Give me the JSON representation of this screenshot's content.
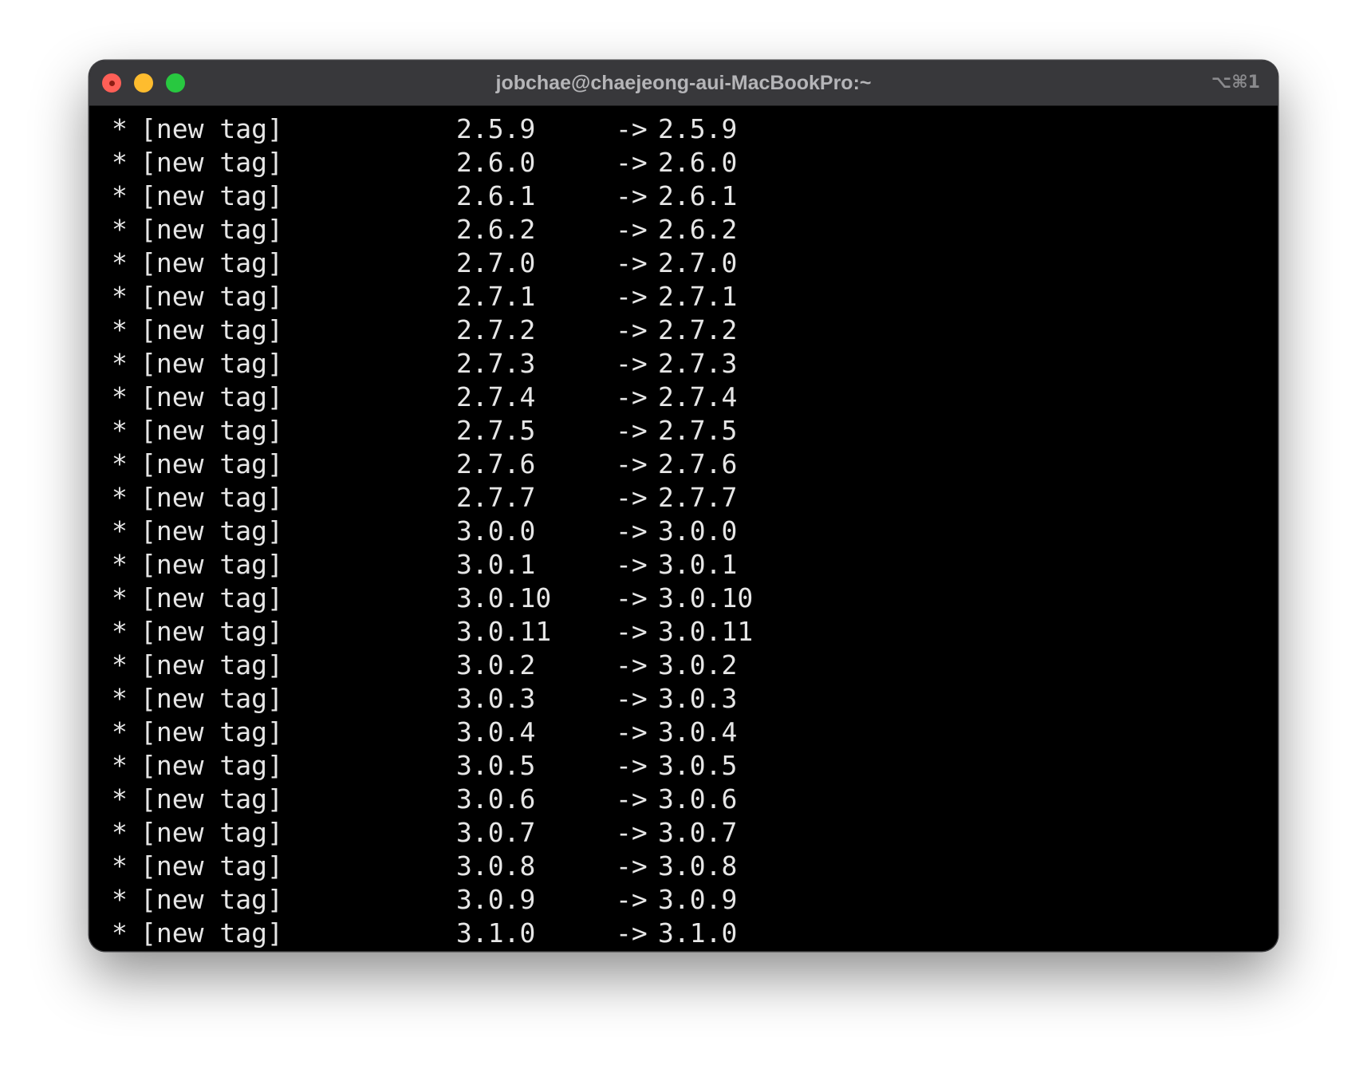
{
  "window": {
    "title": "jobchae@chaejeong-aui-MacBookPro:~",
    "shortcut": "⌥⌘1"
  },
  "terminal": {
    "lines": [
      {
        "marker": "*",
        "label": "[new tag]",
        "from": "2.5.9",
        "arrow": "->",
        "to": "2.5.9"
      },
      {
        "marker": "*",
        "label": "[new tag]",
        "from": "2.6.0",
        "arrow": "->",
        "to": "2.6.0"
      },
      {
        "marker": "*",
        "label": "[new tag]",
        "from": "2.6.1",
        "arrow": "->",
        "to": "2.6.1"
      },
      {
        "marker": "*",
        "label": "[new tag]",
        "from": "2.6.2",
        "arrow": "->",
        "to": "2.6.2"
      },
      {
        "marker": "*",
        "label": "[new tag]",
        "from": "2.7.0",
        "arrow": "->",
        "to": "2.7.0"
      },
      {
        "marker": "*",
        "label": "[new tag]",
        "from": "2.7.1",
        "arrow": "->",
        "to": "2.7.1"
      },
      {
        "marker": "*",
        "label": "[new tag]",
        "from": "2.7.2",
        "arrow": "->",
        "to": "2.7.2"
      },
      {
        "marker": "*",
        "label": "[new tag]",
        "from": "2.7.3",
        "arrow": "->",
        "to": "2.7.3"
      },
      {
        "marker": "*",
        "label": "[new tag]",
        "from": "2.7.4",
        "arrow": "->",
        "to": "2.7.4"
      },
      {
        "marker": "*",
        "label": "[new tag]",
        "from": "2.7.5",
        "arrow": "->",
        "to": "2.7.5"
      },
      {
        "marker": "*",
        "label": "[new tag]",
        "from": "2.7.6",
        "arrow": "->",
        "to": "2.7.6"
      },
      {
        "marker": "*",
        "label": "[new tag]",
        "from": "2.7.7",
        "arrow": "->",
        "to": "2.7.7"
      },
      {
        "marker": "*",
        "label": "[new tag]",
        "from": "3.0.0",
        "arrow": "->",
        "to": "3.0.0"
      },
      {
        "marker": "*",
        "label": "[new tag]",
        "from": "3.0.1",
        "arrow": "->",
        "to": "3.0.1"
      },
      {
        "marker": "*",
        "label": "[new tag]",
        "from": "3.0.10",
        "arrow": "->",
        "to": "3.0.10"
      },
      {
        "marker": "*",
        "label": "[new tag]",
        "from": "3.0.11",
        "arrow": "->",
        "to": "3.0.11"
      },
      {
        "marker": "*",
        "label": "[new tag]",
        "from": "3.0.2",
        "arrow": "->",
        "to": "3.0.2"
      },
      {
        "marker": "*",
        "label": "[new tag]",
        "from": "3.0.3",
        "arrow": "->",
        "to": "3.0.3"
      },
      {
        "marker": "*",
        "label": "[new tag]",
        "from": "3.0.4",
        "arrow": "->",
        "to": "3.0.4"
      },
      {
        "marker": "*",
        "label": "[new tag]",
        "from": "3.0.5",
        "arrow": "->",
        "to": "3.0.5"
      },
      {
        "marker": "*",
        "label": "[new tag]",
        "from": "3.0.6",
        "arrow": "->",
        "to": "3.0.6"
      },
      {
        "marker": "*",
        "label": "[new tag]",
        "from": "3.0.7",
        "arrow": "->",
        "to": "3.0.7"
      },
      {
        "marker": "*",
        "label": "[new tag]",
        "from": "3.0.8",
        "arrow": "->",
        "to": "3.0.8"
      },
      {
        "marker": "*",
        "label": "[new tag]",
        "from": "3.0.9",
        "arrow": "->",
        "to": "3.0.9"
      },
      {
        "marker": "*",
        "label": "[new tag]",
        "from": "3.1.0",
        "arrow": "->",
        "to": "3.1.0"
      }
    ]
  }
}
